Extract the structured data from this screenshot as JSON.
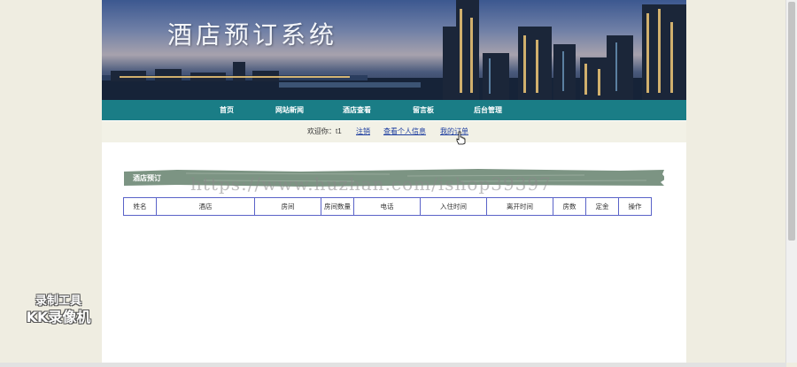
{
  "banner": {
    "title": "酒店预订系统"
  },
  "nav": {
    "items": [
      {
        "label": "首页"
      },
      {
        "label": "网站新闻"
      },
      {
        "label": "酒店查看"
      },
      {
        "label": "留言板"
      },
      {
        "label": "后台管理"
      }
    ]
  },
  "welcome": {
    "text": "欢迎你：t1",
    "links": [
      {
        "label": "注销"
      },
      {
        "label": "查看个人信息"
      },
      {
        "label": "我的订单"
      }
    ]
  },
  "section": {
    "title": "酒店预订"
  },
  "table": {
    "columns": [
      "姓名",
      "酒店",
      "房间",
      "房间数量",
      "电话",
      "入住时间",
      "离开时间",
      "房数",
      "定金",
      "操作"
    ]
  },
  "watermark": "https://www.huzhan.com/ishop39397",
  "badge": {
    "line1": "录制工具",
    "line2": "KK录像机"
  },
  "colors": {
    "nav_bg": "#1a7d86",
    "link": "#1f3fa0",
    "table_border": "#5a63c8",
    "section_header": "#7c9483"
  }
}
